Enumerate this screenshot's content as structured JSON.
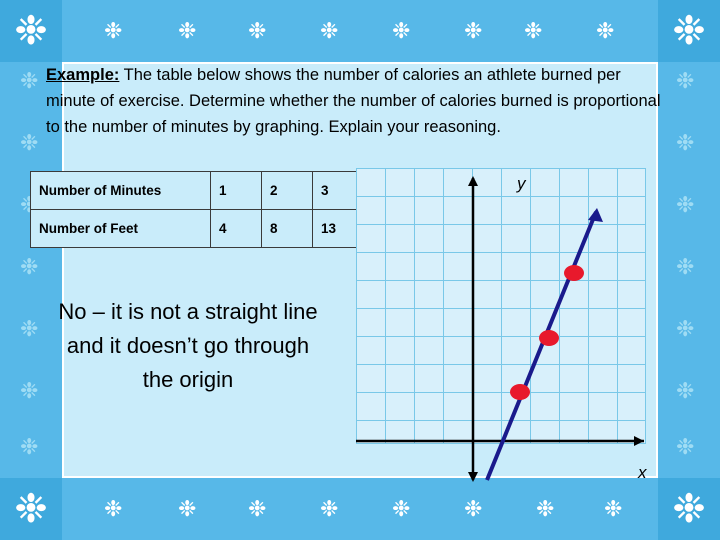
{
  "slide": {
    "prompt": {
      "lead": "Example:",
      "body": " The table below shows the number of calories an athlete burned per minute of exercise.  Determine whether the number of calories burned is proportional to the number of minutes by graphing.  Explain your reasoning."
    },
    "table": {
      "rows": [
        {
          "header": "Number of Minutes",
          "cells": [
            "1",
            "2",
            "3"
          ]
        },
        {
          "header": "Number of Feet",
          "cells": [
            "4",
            "8",
            "13"
          ]
        }
      ]
    },
    "answer": "No – it is not a straight line and it doesn’t go through the origin",
    "graph": {
      "y_axis_label": "y",
      "x_axis_label": "x",
      "grid_color": "#79c8e8",
      "line_color": "#1a1a8c",
      "point_color": "#e8192c",
      "points": [
        {
          "x": 1,
          "y": 4
        },
        {
          "x": 2,
          "y": 8
        },
        {
          "x": 3,
          "y": 13
        }
      ]
    },
    "colors": {
      "background": "#5bc8ef",
      "panel": "#c9ecfa",
      "border_band": "#57b8e8",
      "corner": "#3fa9dd",
      "snowflake": "#ffffff"
    },
    "icons": {
      "snowflake": "❉"
    }
  }
}
